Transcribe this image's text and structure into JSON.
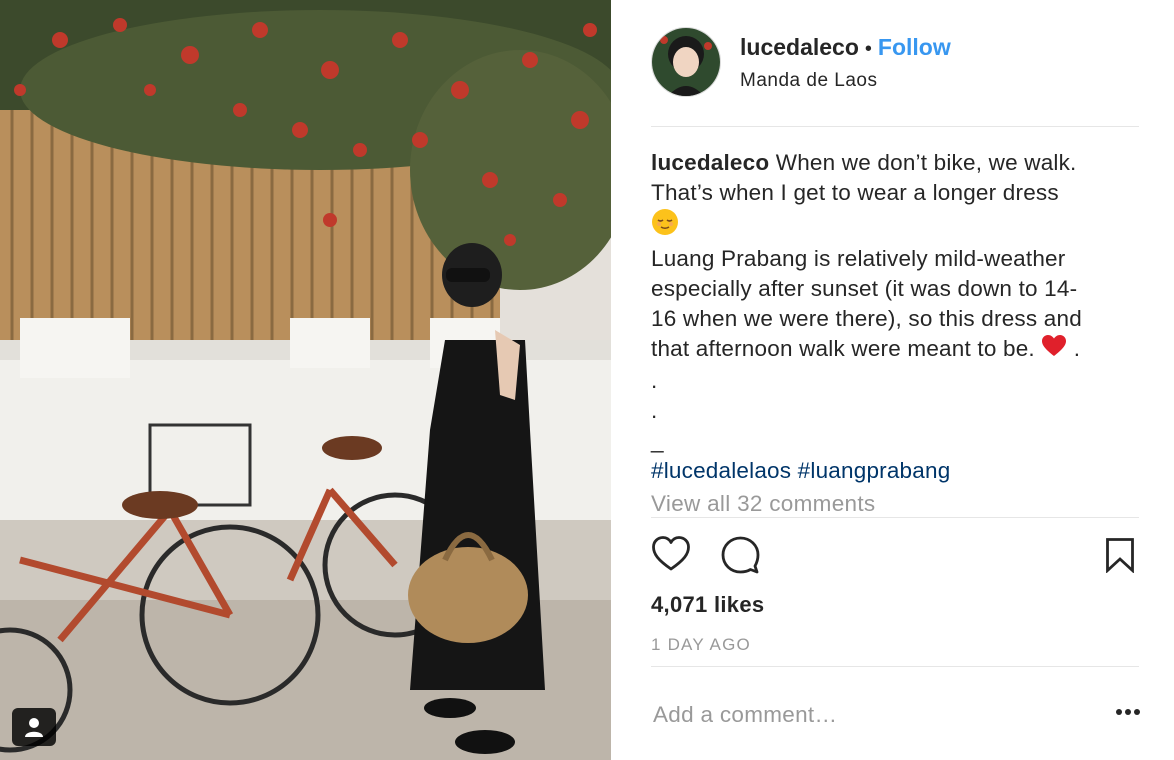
{
  "post": {
    "username": "lucedaleco",
    "separator": "•",
    "follow_label": "Follow",
    "location": "Manda de Laos",
    "caption": {
      "username": "lucedaleco",
      "line1": "When we don’t bike, we walk.",
      "line2": "That’s when I get to wear a longer dress",
      "line3": "Luang Prabang is relatively mild-weather",
      "line4": "especially after sunset (it was down to 14-",
      "line5": "16 when we were there), so this dress and",
      "line6": "that afternoon walk were meant to be.",
      "dot_after_heart": ".",
      "dot1": ".",
      "dot2": ".",
      "underscore": "_",
      "hashtag1": "#lucedalelaos",
      "hashtag2": "#luangprabang"
    },
    "view_comments": "View all 32 comments",
    "likes": "4,071 likes",
    "time_ago": "1 DAY AGO",
    "comment_placeholder": "Add a comment…",
    "more_label": "•••"
  },
  "icons": {
    "like": "heart-outline-icon",
    "comment": "speech-bubble-icon",
    "save": "bookmark-icon",
    "tagged": "person-icon",
    "caption_emoji_1": "relieved-face-emoji",
    "caption_emoji_2": "red-heart-emoji"
  },
  "colors": {
    "follow": "#3897f0",
    "hashtag": "#003569",
    "muted": "#999999",
    "text": "#262626",
    "divider": "#e6e6e6"
  }
}
